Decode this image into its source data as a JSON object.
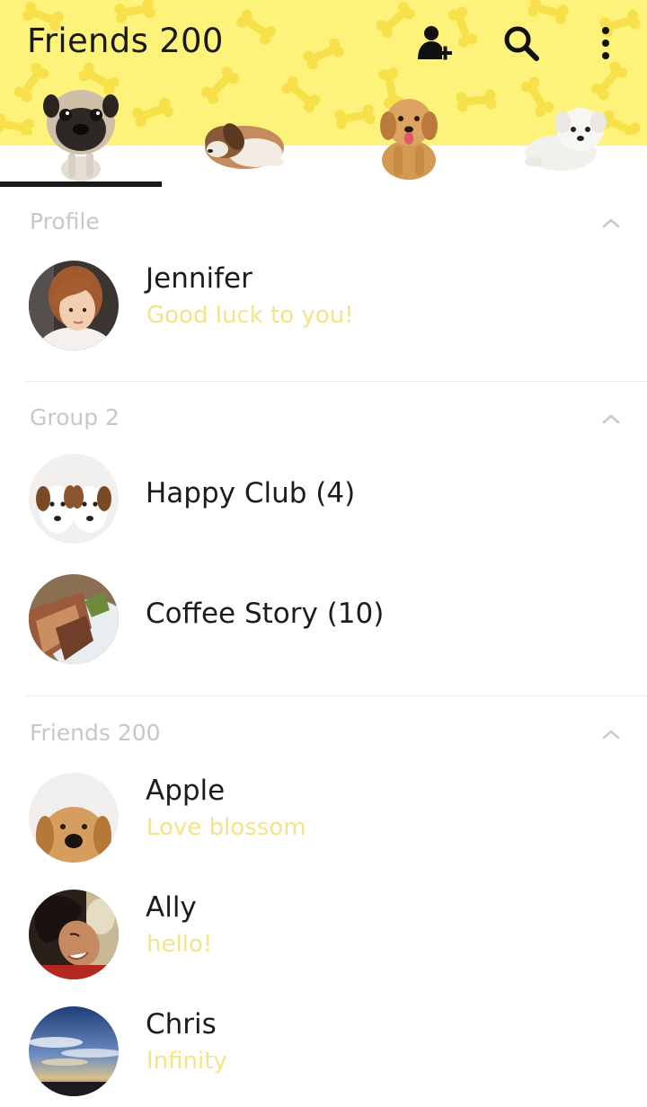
{
  "header": {
    "title": "Friends 200",
    "actions": [
      {
        "icon": "add-friend-icon"
      },
      {
        "icon": "search-icon"
      },
      {
        "icon": "more-vertical-icon"
      }
    ],
    "tabs": [
      {
        "icon": "pug-icon",
        "selected": true
      },
      {
        "icon": "beagle-icon",
        "selected": false
      },
      {
        "icon": "golden-puppy-icon",
        "selected": false
      },
      {
        "icon": "white-puppy-icon",
        "selected": false
      }
    ]
  },
  "sections": {
    "profile": {
      "label": "Profile",
      "items": [
        {
          "name": "Jennifer",
          "status": "Good luck to you!"
        }
      ]
    },
    "groups": {
      "label": "Group 2",
      "items": [
        {
          "name": "Happy Club (4)"
        },
        {
          "name": "Coffee Story (10)"
        }
      ]
    },
    "friends": {
      "label": "Friends 200",
      "items": [
        {
          "name": "Apple",
          "status": "Love blossom"
        },
        {
          "name": "Ally",
          "status": "hello!"
        },
        {
          "name": "Chris",
          "status": "Infinity"
        }
      ]
    }
  },
  "colors": {
    "header_yellow": "#fdf27a",
    "status_text": "#f5e387",
    "section_label": "#c7c7c7"
  }
}
